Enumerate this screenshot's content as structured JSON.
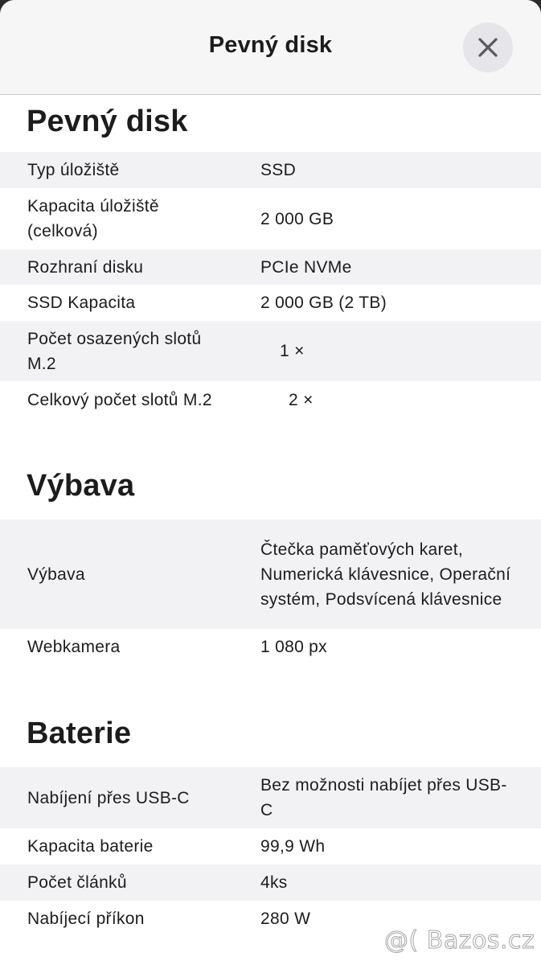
{
  "header": {
    "title": "Pevný disk",
    "close_icon": "close-icon"
  },
  "sections": [
    {
      "title": "Pevný disk",
      "rows": [
        {
          "label": "Typ úložiště",
          "value": "SSD"
        },
        {
          "label": "Kapacita úložiště (celková)",
          "value": "2 000 GB"
        },
        {
          "label": "Rozhraní disku",
          "value": "PCIe NVMe"
        },
        {
          "label": "SSD Kapacita",
          "value": "2 000 GB (2 TB)"
        },
        {
          "label": "Počet osazených slotů M.2",
          "value": "1 ×"
        },
        {
          "label": "Celkový počet slotů M.2",
          "value": "2 ×"
        }
      ]
    },
    {
      "title": "Výbava",
      "rows": [
        {
          "label": "Výbava",
          "value": "Čtečka paměťových karet, Numerická klávesnice, Operační systém, Podsvícená klávesnice"
        },
        {
          "label": "Webkamera",
          "value": "1 080 px"
        }
      ]
    },
    {
      "title": "Baterie",
      "rows": [
        {
          "label": "Nabíjení přes USB-C",
          "value": "Bez možnosti nabíjet přes USB-C"
        },
        {
          "label": "Kapacita baterie",
          "value": "99,9 Wh"
        },
        {
          "label": "Počet článků",
          "value": "4ks"
        },
        {
          "label": "Nabíjecí příkon",
          "value": "280 W"
        }
      ]
    }
  ],
  "watermark": "@( Bazos.cz"
}
